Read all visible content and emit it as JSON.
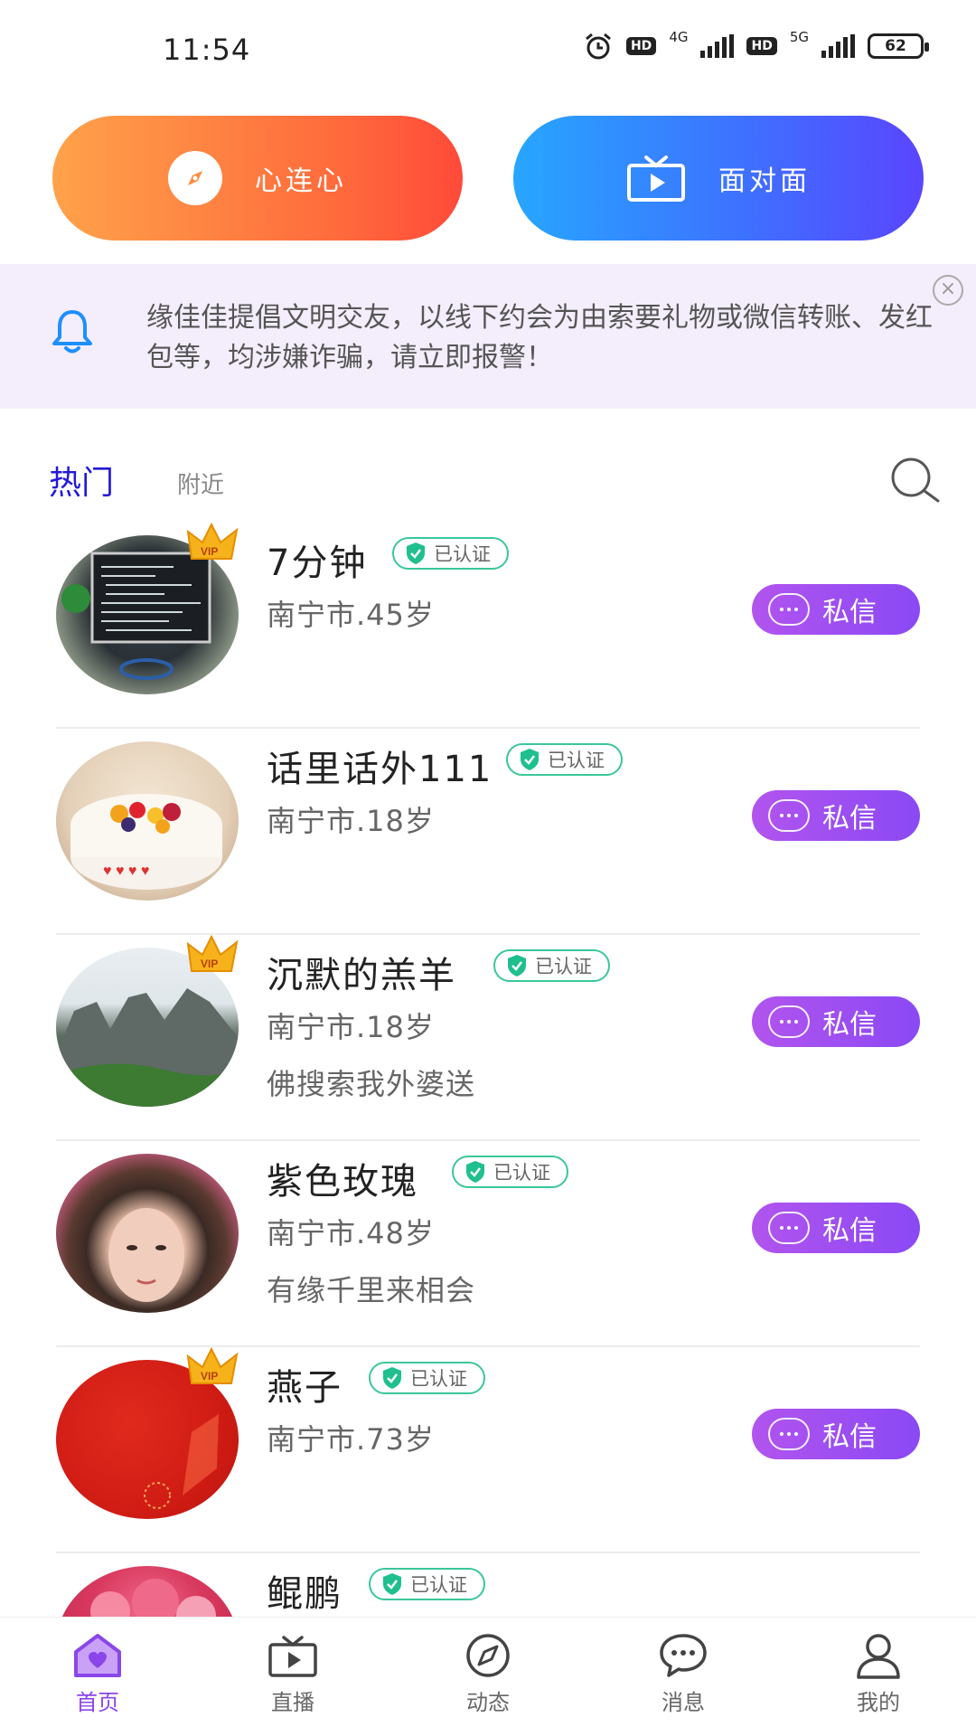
{
  "status_bar": {
    "time": "11:54",
    "network_1": "4G",
    "network_2": "5G",
    "hd_label": "HD",
    "battery": "62",
    "icons": [
      "alarm-icon",
      "hd-icon",
      "signal-icon",
      "hd-icon",
      "signal-icon",
      "battery-icon"
    ]
  },
  "top_buttons": {
    "heart_to_heart": {
      "label": "心连心",
      "icon": "compass-icon"
    },
    "face_to_face": {
      "label": "面对面",
      "icon": "tv-icon"
    }
  },
  "notice": {
    "text": "缘佳佳提倡文明交友，以线下约会为由索要礼物或微信转账、发红包等，均涉嫌诈骗，请立即报警！",
    "icon": "bell-icon",
    "close_icon": "close-icon"
  },
  "tabs": {
    "hot": "热门",
    "nearby": "附近",
    "active": "hot",
    "active_color": "#2418d8"
  },
  "verified_label": "已认证",
  "message_label": "私信",
  "users": [
    {
      "name": "7分钟",
      "meta": "南宁市.45岁",
      "sign": "",
      "vip": true
    },
    {
      "name": "话里话外111",
      "meta": "南宁市.18岁",
      "sign": "",
      "vip": false
    },
    {
      "name": "沉默的羔羊",
      "meta": "南宁市.18岁",
      "sign": "佛搜索我外婆送",
      "vip": true
    },
    {
      "name": "紫色玫瑰",
      "meta": "南宁市.48岁",
      "sign": "有缘千里来相会",
      "vip": false
    },
    {
      "name": "燕子",
      "meta": "南宁市.73岁",
      "sign": "",
      "vip": true
    },
    {
      "name": "鲲鹏",
      "meta": "",
      "sign": "",
      "vip": false
    }
  ],
  "bottom_nav": {
    "items": [
      {
        "label": "首页",
        "icon": "home-icon",
        "active": true
      },
      {
        "label": "直播",
        "icon": "tv-icon",
        "active": false
      },
      {
        "label": "动态",
        "icon": "compass-icon",
        "active": false
      },
      {
        "label": "消息",
        "icon": "chat-icon",
        "active": false
      },
      {
        "label": "我的",
        "icon": "profile-icon",
        "active": false
      }
    ],
    "active_color": "#8a46ea"
  },
  "colors": {
    "accent_purple": "#8a49f4",
    "verified_green": "#3ac79a",
    "notice_bg": "#f4edfb"
  }
}
